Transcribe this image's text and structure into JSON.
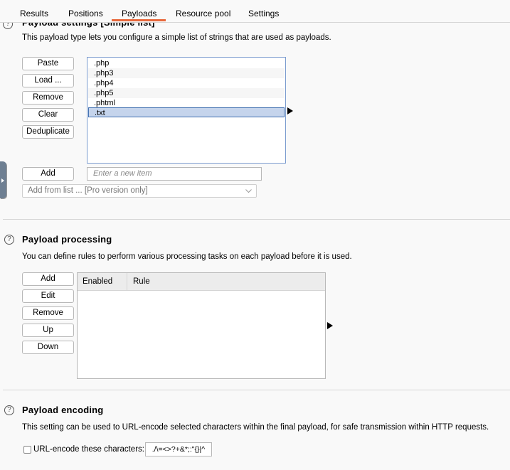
{
  "tabs": [
    {
      "label": "Results",
      "active": false
    },
    {
      "label": "Positions",
      "active": false
    },
    {
      "label": "Payloads",
      "active": true
    },
    {
      "label": "Resource pool",
      "active": false
    },
    {
      "label": "Settings",
      "active": false
    }
  ],
  "accent_color": "#e8683c",
  "payload_settings": {
    "title": "Payload settings [Simple list]",
    "description": "This payload type lets you configure a simple list of strings that are used as payloads.",
    "buttons": {
      "paste": "Paste",
      "load": "Load ...",
      "remove": "Remove",
      "clear": "Clear",
      "deduplicate": "Deduplicate",
      "add": "Add"
    },
    "items": [
      ".php",
      ".php3",
      ".php4",
      ".php5",
      ".phtml",
      ".txt"
    ],
    "selected_item": ".txt",
    "new_item_placeholder": "Enter a new item",
    "add_from_list": "Add from list ... [Pro version only]"
  },
  "payload_processing": {
    "title": "Payload processing",
    "description": "You can define rules to perform various processing tasks on each payload before it is used.",
    "buttons": {
      "add": "Add",
      "edit": "Edit",
      "remove": "Remove",
      "up": "Up",
      "down": "Down"
    },
    "columns": [
      "Enabled",
      "Rule"
    ],
    "rows": []
  },
  "payload_encoding": {
    "title": "Payload encoding",
    "description": "This setting can be used to URL-encode selected characters within the final payload, for safe transmission within HTTP requests.",
    "checkbox_label": "URL-encode these characters:",
    "checked": false,
    "characters": "./\\=<>?+&*;:\"{}|^"
  },
  "help_icon_glyph": "?"
}
